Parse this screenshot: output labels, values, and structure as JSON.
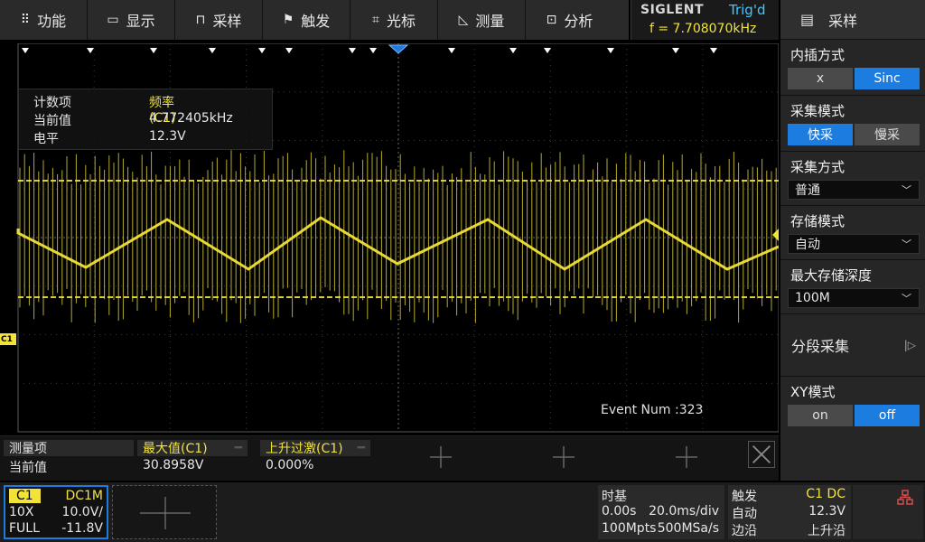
{
  "menu": [
    {
      "icon": "grid-icon",
      "glyph": "⠿",
      "label": "功能"
    },
    {
      "icon": "display-icon",
      "glyph": "▭",
      "label": "显示"
    },
    {
      "icon": "sample-icon",
      "glyph": "⊓",
      "label": "采样"
    },
    {
      "icon": "trigger-flag-icon",
      "glyph": "⚑",
      "label": "触发"
    },
    {
      "icon": "cursor-icon",
      "glyph": "⌗",
      "label": "光标"
    },
    {
      "icon": "measure-icon",
      "glyph": "◺",
      "label": "测量"
    },
    {
      "icon": "analyze-icon",
      "glyph": "⊡",
      "label": "分析"
    }
  ],
  "brand": {
    "name": "SIGLENT",
    "trig_state": "Trig'd",
    "freq": "f = 7.708070kHz"
  },
  "right_panel": {
    "title": "采样",
    "interp": {
      "label": "内插方式",
      "options": [
        "x",
        "Sinc"
      ],
      "selected": 1
    },
    "acq_mode": {
      "label": "采集模式",
      "options": [
        "快采",
        "慢采"
      ],
      "selected": 0
    },
    "acq_type": {
      "label": "采集方式",
      "value": "普通"
    },
    "mem_mode": {
      "label": "存储模式",
      "value": "自动"
    },
    "max_depth": {
      "label": "最大存储深度",
      "value": "100M"
    },
    "segmented": {
      "label": "分段采集"
    },
    "xy": {
      "label": "XY模式",
      "options": [
        "on",
        "off"
      ],
      "selected": 1
    }
  },
  "counter": {
    "row1": {
      "label": "计数项",
      "value": "频率(C1)"
    },
    "row2": {
      "label": "当前值",
      "value": "4.772405kHz"
    },
    "row3": {
      "label": "电平",
      "value": "12.3V"
    }
  },
  "event_num": "Event Num :323",
  "channel_marker": "C1",
  "measure": {
    "label_header": "测量项",
    "label_value": "当前值",
    "items": [
      {
        "name": "最大值(C1)",
        "value": "30.8958V"
      },
      {
        "name": "上升过激(C1)",
        "value": "0.000%"
      }
    ]
  },
  "ch1": {
    "name": "C1",
    "coupling": "DC1M",
    "probe": "10X",
    "scale": "10.0V/",
    "bw": "FULL",
    "offset": "-11.8V"
  },
  "timebase": {
    "title": "时基",
    "delay": "0.00s",
    "scale": "20.0ms/div",
    "mem": "100Mpts",
    "rate": "500MSa/s"
  },
  "trigger": {
    "title": "触发",
    "source": "C1 DC",
    "mode": "自动",
    "level": "12.3V",
    "type": "边沿",
    "slope": "上升沿"
  },
  "colors": {
    "trace": "#f2e33a",
    "accent": "#1c7ce0",
    "trig": "#3fc7ff"
  }
}
